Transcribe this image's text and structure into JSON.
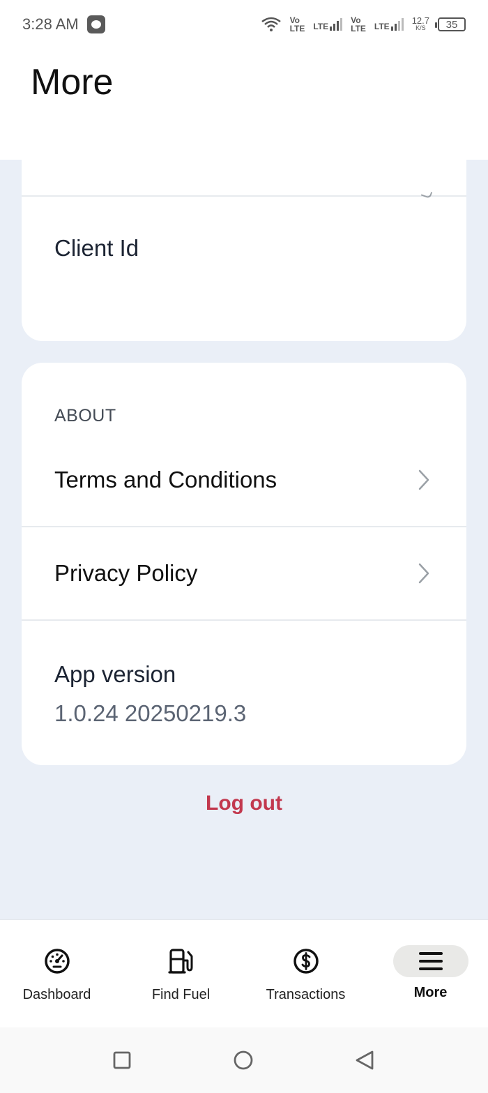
{
  "status_bar": {
    "time": "3:28 AM",
    "sim1_top": "Vo",
    "sim1_bottom": "LTE",
    "lte1": "LTE",
    "sim2_top": "Vo",
    "sim2_bottom": "LTE",
    "lte2": "LTE",
    "net_speed": "12.7",
    "net_unit": "K/S",
    "battery": "35"
  },
  "header": {
    "title": "More"
  },
  "account_card": {
    "client_label": "Client Id"
  },
  "about_card": {
    "section_label": "ABOUT",
    "terms_label": "Terms and Conditions",
    "privacy_label": "Privacy Policy",
    "version_label": "App version",
    "version_value": "1.0.24 20250219.3"
  },
  "logout_label": "Log out",
  "bottom_nav": {
    "items": [
      {
        "label": "Dashboard",
        "icon": "dashboard-gauge-icon"
      },
      {
        "label": "Find Fuel",
        "icon": "fuel-pump-icon"
      },
      {
        "label": "Transactions",
        "icon": "dollar-circle-icon"
      },
      {
        "label": "More",
        "icon": "menu-icon",
        "active": true
      }
    ]
  },
  "colors": {
    "background": "#eaeff7",
    "card": "#ffffff",
    "logout": "#c2384e",
    "active_pill": "#e9e9e7"
  }
}
